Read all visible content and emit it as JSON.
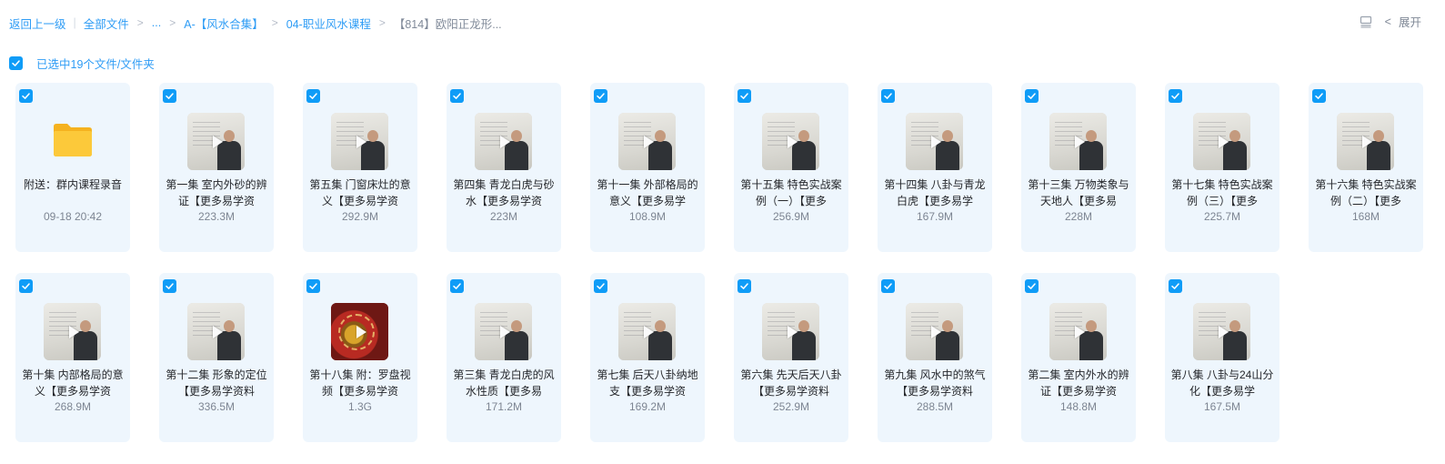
{
  "breadcrumb": {
    "back": "返回上一级",
    "all_files": "全部文件",
    "ellipsis": "...",
    "level1": "A-【风水合集】",
    "level2": "04-职业风水课程",
    "current": "【814】欧阳正龙形..."
  },
  "toolbar": {
    "list_icon": "list-view-icon",
    "expand_label": "展开"
  },
  "selection": {
    "label": "已选中19个文件/文件夹",
    "checked": true
  },
  "colors": {
    "accent": "#0f9cf7",
    "card_bg": "#eef6fd",
    "folder": "#fbc52d"
  },
  "items": [
    {
      "type": "folder",
      "name": "附送：群内课程录音",
      "meta": "09-18 20:42"
    },
    {
      "type": "video",
      "name": "第一集 室内外砂的辨证【更多易学资",
      "meta": "223.3M"
    },
    {
      "type": "video",
      "name": "第五集 门窗床灶的意义【更多易学资",
      "meta": "292.9M"
    },
    {
      "type": "video",
      "name": "第四集 青龙白虎与砂水【更多易学资",
      "meta": "223M"
    },
    {
      "type": "video",
      "name": "第十一集 外部格局的意义【更多易学",
      "meta": "108.9M"
    },
    {
      "type": "video",
      "name": "第十五集 特色实战案例（一）【更多",
      "meta": "256.9M"
    },
    {
      "type": "video",
      "name": "第十四集 八卦与青龙白虎【更多易学",
      "meta": "167.9M"
    },
    {
      "type": "video",
      "name": "第十三集 万物类象与天地人【更多易",
      "meta": "228M"
    },
    {
      "type": "video",
      "name": "第十七集 特色实战案例（三）【更多",
      "meta": "225.7M"
    },
    {
      "type": "video",
      "name": "第十六集 特色实战案例（二）【更多",
      "meta": "168M"
    },
    {
      "type": "video",
      "name": "第十集 内部格局的意义【更多易学资",
      "meta": "268.9M"
    },
    {
      "type": "video",
      "name": "第十二集 形象的定位【更多易学资料",
      "meta": "336.5M"
    },
    {
      "type": "video-compass",
      "name": "第十八集 附：罗盘视频【更多易学资",
      "meta": "1.3G"
    },
    {
      "type": "video",
      "name": "第三集 青龙白虎的风水性质【更多易",
      "meta": "171.2M"
    },
    {
      "type": "video",
      "name": "第七集 后天八卦纳地支【更多易学资",
      "meta": "169.2M"
    },
    {
      "type": "video",
      "name": "第六集 先天后天八卦【更多易学资料",
      "meta": "252.9M"
    },
    {
      "type": "video",
      "name": "第九集 风水中的煞气【更多易学资料",
      "meta": "288.5M"
    },
    {
      "type": "video",
      "name": "第二集 室内外水的辨证【更多易学资",
      "meta": "148.8M"
    },
    {
      "type": "video",
      "name": "第八集 八卦与24山分化【更多易学",
      "meta": "167.5M"
    }
  ]
}
